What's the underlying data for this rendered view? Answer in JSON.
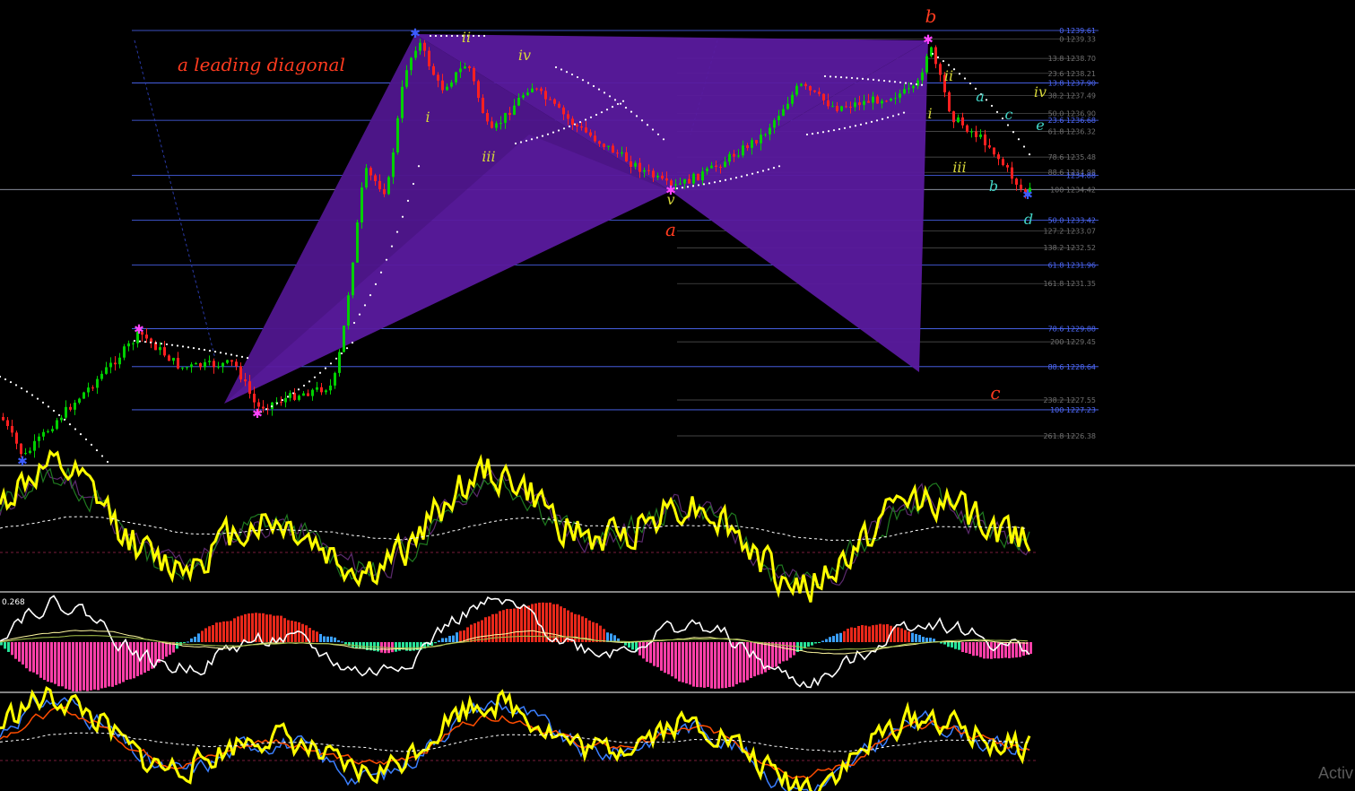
{
  "chart_data": [
    {
      "type": "line",
      "panel": "price",
      "annotations": {
        "title": "a leading diagonal",
        "waves": [
          "ii",
          "iv",
          "i",
          "iii",
          "v",
          "a",
          "b",
          "c",
          "ii",
          "a",
          "c",
          "iv",
          "e",
          "i",
          "iii",
          "b",
          "d"
        ]
      },
      "fib_levels": [
        {
          "label": "0 1239.61",
          "value": 1239.61,
          "color": "#4f6bff"
        },
        {
          "label": "0 1239.33",
          "value": 1239.33,
          "color": "#707070"
        },
        {
          "label": "13.8 1238.70",
          "value": 1238.7,
          "color": "#707070"
        },
        {
          "label": "23.6 1238.21",
          "value": 1238.21,
          "color": "#707070"
        },
        {
          "label": "13.8 1237.90",
          "value": 1237.9,
          "color": "#4f6bff"
        },
        {
          "label": "38.2 1237.49",
          "value": 1237.49,
          "color": "#707070"
        },
        {
          "label": "50.0 1236.90",
          "value": 1236.9,
          "color": "#707070"
        },
        {
          "label": "23.6 1236.68",
          "value": 1236.68,
          "color": "#4f6bff"
        },
        {
          "label": "61.8 1236.32",
          "value": 1236.32,
          "color": "#707070"
        },
        {
          "label": "78.6 1235.48",
          "value": 1235.48,
          "color": "#707070"
        },
        {
          "label": "88.6 1234.98",
          "value": 1234.98,
          "color": "#707070"
        },
        {
          "label": "1234.88",
          "value": 1234.88,
          "color": "#4f6bff"
        },
        {
          "label": "100 1234.42",
          "value": 1234.42,
          "color": "#707070"
        },
        {
          "label": "50.0 1233.42",
          "value": 1233.42,
          "color": "#4f6bff"
        },
        {
          "label": "127.2 1233.07",
          "value": 1233.07,
          "color": "#707070"
        },
        {
          "label": "138.2 1232.52",
          "value": 1232.52,
          "color": "#707070"
        },
        {
          "label": "61.8 1231.96",
          "value": 1231.96,
          "color": "#4f6bff"
        },
        {
          "label": "161.8 1231.35",
          "value": 1231.35,
          "color": "#707070"
        },
        {
          "label": "78.6 1229.88",
          "value": 1229.88,
          "color": "#4f6bff"
        },
        {
          "label": "200 1229.45",
          "value": 1229.45,
          "color": "#707070"
        },
        {
          "label": "88.6 1228.64",
          "value": 1228.64,
          "color": "#4f6bff"
        },
        {
          "label": "238.2 1227.55",
          "value": 1227.55,
          "color": "#707070"
        },
        {
          "label": "100 1227.23",
          "value": 1227.23,
          "color": "#4f6bff"
        },
        {
          "label": "261.8 1226.38",
          "value": 1226.38,
          "color": "#707070"
        }
      ],
      "current_price": 1234.42,
      "colors": {
        "up": "#00d000",
        "down": "#ff2020",
        "pattern": "#5a1a9e",
        "sar": "#ffffff",
        "hline": "#4f6bff",
        "fib": "#707070",
        "wave_red": "#ff3b1f",
        "wave_yellow": "#d6d63a",
        "wave_cyan": "#43d6c8"
      }
    },
    {
      "type": "line",
      "panel": "oscillator-1",
      "series": [
        {
          "values": []
        },
        {
          "values": []
        },
        {
          "values": []
        }
      ],
      "colors": {
        "main": "#ffff00",
        "signal": "#ffffff",
        "aux1": "#5c2a6e",
        "aux2": "#1f7a1f",
        "level": "#a0264e"
      }
    },
    {
      "type": "bar",
      "panel": "oscillator-2",
      "label": "0.268",
      "colors": {
        "bull_strong": "#e8281a",
        "bull_weak": "#3aa0ff",
        "bear_strong": "#ff3fa8",
        "bear_weak": "#27e39a",
        "line1": "#ffffff",
        "line2": "#fff9a0",
        "line3": "#a5c24a"
      }
    },
    {
      "type": "line",
      "panel": "oscillator-3",
      "colors": {
        "main": "#ffff00",
        "band": "#3b7fff",
        "mid": "#ff4d00",
        "signal": "#ffffff",
        "level": "#a0264e"
      }
    }
  ],
  "watermark": "Activ"
}
